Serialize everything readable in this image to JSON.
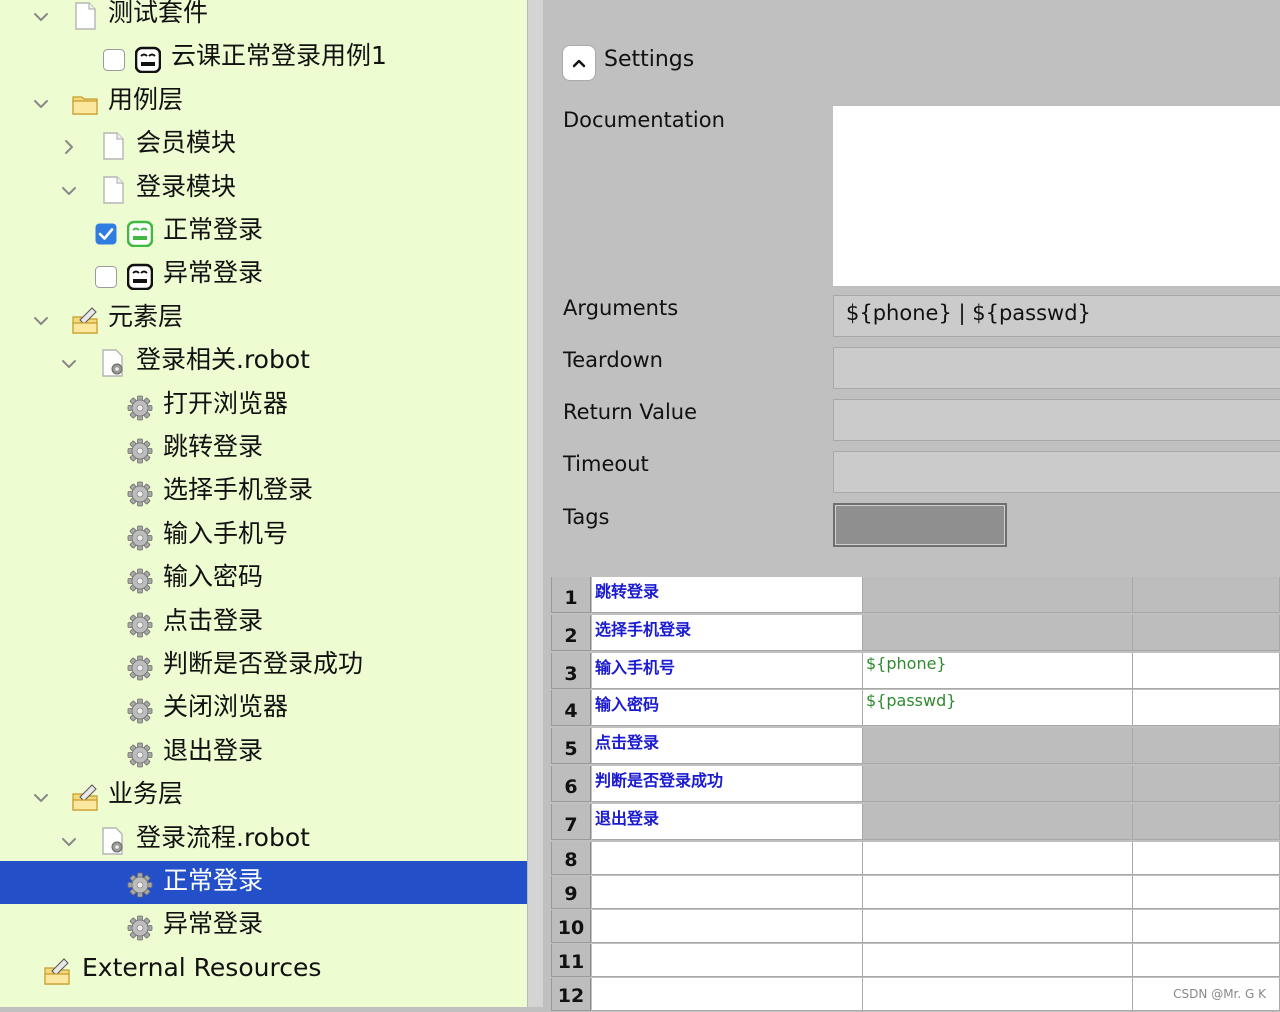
{
  "tree": {
    "rows": [
      {
        "label": "测试套件",
        "chevron": "down",
        "icon": "file-icon",
        "check": null
      },
      {
        "label": "云课正常登录用例1",
        "chevron": null,
        "icon": "robot-icon-dark",
        "check": false
      },
      {
        "label": "用例层",
        "chevron": "down",
        "icon": "folder-icon",
        "check": null
      },
      {
        "label": "会员模块",
        "chevron": "right",
        "icon": "file-icon",
        "check": null
      },
      {
        "label": "登录模块",
        "chevron": "down",
        "icon": "file-icon",
        "check": null
      },
      {
        "label": "正常登录",
        "chevron": null,
        "icon": "robot-icon-green",
        "check": true
      },
      {
        "label": "异常登录",
        "chevron": null,
        "icon": "robot-icon-dark",
        "check": false
      },
      {
        "label": "元素层",
        "chevron": "down",
        "icon": "resource-folder-icon",
        "check": null
      },
      {
        "label": "登录相关.robot",
        "chevron": "down",
        "icon": "resource-file-icon",
        "check": null
      },
      {
        "label": "打开浏览器",
        "chevron": null,
        "icon": "gear-icon",
        "check": null
      },
      {
        "label": "跳转登录",
        "chevron": null,
        "icon": "gear-icon",
        "check": null
      },
      {
        "label": "选择手机登录",
        "chevron": null,
        "icon": "gear-icon",
        "check": null
      },
      {
        "label": "输入手机号",
        "chevron": null,
        "icon": "gear-icon",
        "check": null
      },
      {
        "label": "输入密码",
        "chevron": null,
        "icon": "gear-icon",
        "check": null
      },
      {
        "label": "点击登录",
        "chevron": null,
        "icon": "gear-icon",
        "check": null
      },
      {
        "label": "判断是否登录成功",
        "chevron": null,
        "icon": "gear-icon",
        "check": null
      },
      {
        "label": "关闭浏览器",
        "chevron": null,
        "icon": "gear-icon",
        "check": null
      },
      {
        "label": "退出登录",
        "chevron": null,
        "icon": "gear-icon",
        "check": null
      },
      {
        "label": "业务层",
        "chevron": "down",
        "icon": "resource-folder-icon",
        "check": null
      },
      {
        "label": "登录流程.robot",
        "chevron": "down",
        "icon": "resource-file-icon",
        "check": null
      },
      {
        "label": "正常登录",
        "chevron": null,
        "icon": "gear-icon",
        "check": null,
        "selected": true
      },
      {
        "label": "异常登录",
        "chevron": null,
        "icon": "gear-icon",
        "check": null
      },
      {
        "label": "External Resources",
        "chevron": null,
        "icon": "resource-folder-icon",
        "check": null
      }
    ]
  },
  "settings": {
    "title": "Settings",
    "documentation_label": "Documentation",
    "documentation_value": "",
    "arguments_label": "Arguments",
    "arguments_value": "${phone} | ${passwd}",
    "teardown_label": "Teardown",
    "teardown_value": "",
    "return_label": "Return Value",
    "return_value": "",
    "timeout_label": "Timeout",
    "timeout_value": "",
    "tags_label": "Tags"
  },
  "grid": {
    "rows": [
      {
        "num": "1",
        "kw": "跳转登录",
        "arg1": "",
        "arg1_bg": "grey"
      },
      {
        "num": "2",
        "kw": "选择手机登录",
        "arg1": "",
        "arg1_bg": "grey"
      },
      {
        "num": "3",
        "kw": "输入手机号",
        "arg1": "${phone}",
        "arg1_bg": "white"
      },
      {
        "num": "4",
        "kw": "输入密码",
        "arg1": "${passwd}",
        "arg1_bg": "white"
      },
      {
        "num": "5",
        "kw": "点击登录",
        "arg1": "",
        "arg1_bg": "grey"
      },
      {
        "num": "6",
        "kw": "判断是否登录成功",
        "arg1": "",
        "arg1_bg": "grey"
      },
      {
        "num": "7",
        "kw": "退出登录",
        "arg1": "",
        "arg1_bg": "grey"
      },
      {
        "num": "8",
        "kw": "",
        "arg1": "",
        "arg1_bg": "white"
      },
      {
        "num": "9",
        "kw": "",
        "arg1": "",
        "arg1_bg": "white"
      },
      {
        "num": "10",
        "kw": "",
        "arg1": "",
        "arg1_bg": "white"
      },
      {
        "num": "11",
        "kw": "",
        "arg1": "",
        "arg1_bg": "white"
      },
      {
        "num": "12",
        "kw": "",
        "arg1": "",
        "arg1_bg": "white"
      }
    ]
  },
  "watermark": "CSDN @Mr. G K",
  "colors": {
    "tree_bg": "#eefcd1",
    "selection": "#2350c8",
    "keyword": "#1a1ad0",
    "argument": "#2e8b2e",
    "checkbox": "#2f7de1"
  }
}
